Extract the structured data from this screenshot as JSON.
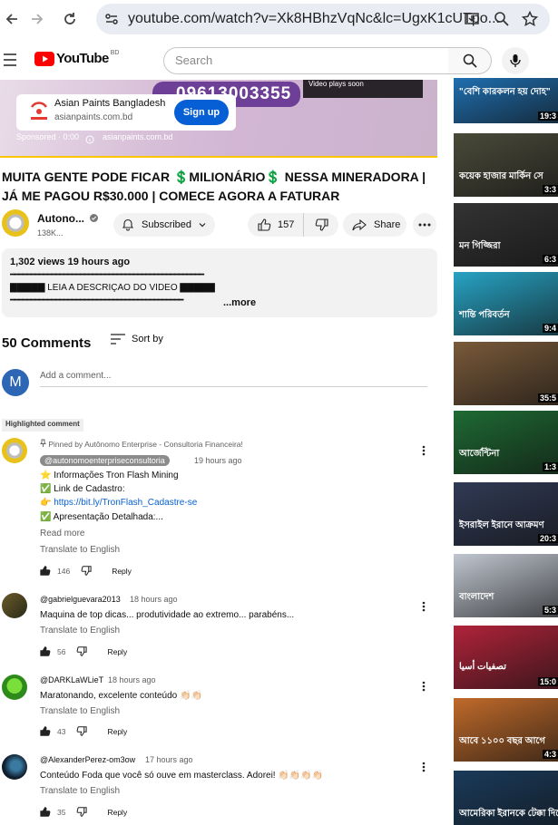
{
  "browser": {
    "url": "youtube.com/watch?v=Xk8HBhzVqNc&lc=UgxK1cUTpo...",
    "colors": {
      "bar": "#ffffff",
      "urlbox": "#e9edf3"
    }
  },
  "header": {
    "logo_text": "YouTube",
    "country": "BD",
    "search_placeholder": "Search"
  },
  "ad": {
    "phone": "09613003355",
    "advertiser": "Asian Paints Bangladesh",
    "domain": "asianpaints.com.bd",
    "cta": "Sign up",
    "sponsored": "Sponsored · 0:00",
    "footer_domain": "asianpaints.com.bd",
    "next_label": "Video plays soon",
    "progress_fraction": 1.0
  },
  "video": {
    "title": "MUITA GENTE PODE FICAR 💲MILIONÁRIO💲 NESSA MINERADORA | JÁ ME PAGOU R$30.000 | COMECE AGORA A FATURAR",
    "channel": "Autono...",
    "subs": "138K...",
    "subscribed_label": "Subscribed",
    "likes": "157",
    "share_label": "Share"
  },
  "description": {
    "stats": "1,302 views  19 hours ago",
    "line1": "━━━━━━━━━━━━━━━━━━━━━━━━━━━━━━━━━━━━━━━━━━━━━━━",
    "line2": "▇▇▇▇▇ LEIA A DESCRIÇÃO DO VÍDEO ▇▇▇▇▇",
    "line3": "━━━━━━━━━━━━━━━━━━━━━━━━━━━━━━━━━━━━━━━━━━",
    "more": "...more"
  },
  "comments_header": {
    "count_label": "50 Comments",
    "sort_label": "Sort by",
    "add_placeholder": "Add a comment...",
    "me_initial": "M"
  },
  "highlight_label": "Highlighted comment",
  "comments": [
    {
      "pinned": "Pinned by Autônomo Enterprise - Consultoria Financeira!",
      "author": "@autonomoenterpriseconsultoria",
      "time": "19 hours ago",
      "lines": [
        "⭐ Informações Tron Flash Mining",
        "✅ Link de Cadastro:",
        "👉 https://bit.ly/TronFlash_Cadastre-se",
        "✅ Apresentação Detalhada:..."
      ],
      "read_more": "Read more",
      "translate": "Translate to English",
      "likes": "146",
      "reply": "Reply"
    },
    {
      "author": "@gabrielguevara2013",
      "time": "18 hours ago",
      "lines": [
        "Maquina de top dicas... produtividade ao extremo... parabéns..."
      ],
      "translate": "Translate to English",
      "likes": "56",
      "reply": "Reply"
    },
    {
      "author": "@DARKLaWLieT",
      "time": "18 hours ago",
      "lines": [
        "Maratonando, excelente conteúdo 👏🏻👏🏻"
      ],
      "translate": "Translate to English",
      "likes": "43",
      "reply": "Reply"
    },
    {
      "author": "@AlexanderPerez-om3ow",
      "time": "17 hours ago",
      "lines": [
        "Conteúdo Foda que você só ouve em masterclass. Adorei! 👏🏻👏🏻👏🏻👏🏻"
      ],
      "translate": "Translate to English",
      "likes": "35",
      "reply": "Reply"
    }
  ],
  "sidebar": [
    {
      "duration": "19:3",
      "text": "\"বেশি কারকলন হয় দোহ\"",
      "color": "#1f6fb0"
    },
    {
      "duration": "3:3",
      "text": "কয়েক হাজার মার্কিন সে",
      "color": "#4a4a3a"
    },
    {
      "duration": "6:3",
      "text": "মন গিজ্জিরা",
      "color": "#333333"
    },
    {
      "duration": "9:4",
      "text": "শান্তি পরিবর্তন",
      "color": "#27a3c4"
    },
    {
      "duration": "35:5",
      "text": "",
      "color": "#7a5a3a"
    },
    {
      "duration": "1:3",
      "text": "আর্জেন্টিনা",
      "color": "#1e6a33"
    },
    {
      "duration": "20:3",
      "text": "ইসরাইল ইরানে আক্রমণ",
      "color": "#303a55"
    },
    {
      "duration": "5:3",
      "text": "বাংলাদেশ",
      "color": "#c0c6d0"
    },
    {
      "duration": "15:0",
      "text": "تصفيات أسيا",
      "color": "#b0233a"
    },
    {
      "duration": "4:3",
      "text": "আবে ১১০০ বছর আগে",
      "color": "#c06a2a"
    },
    {
      "duration": "",
      "text": "আমেরিকা ইরানকে টেক্কা দিতে",
      "color": "#1a3a5a"
    }
  ]
}
